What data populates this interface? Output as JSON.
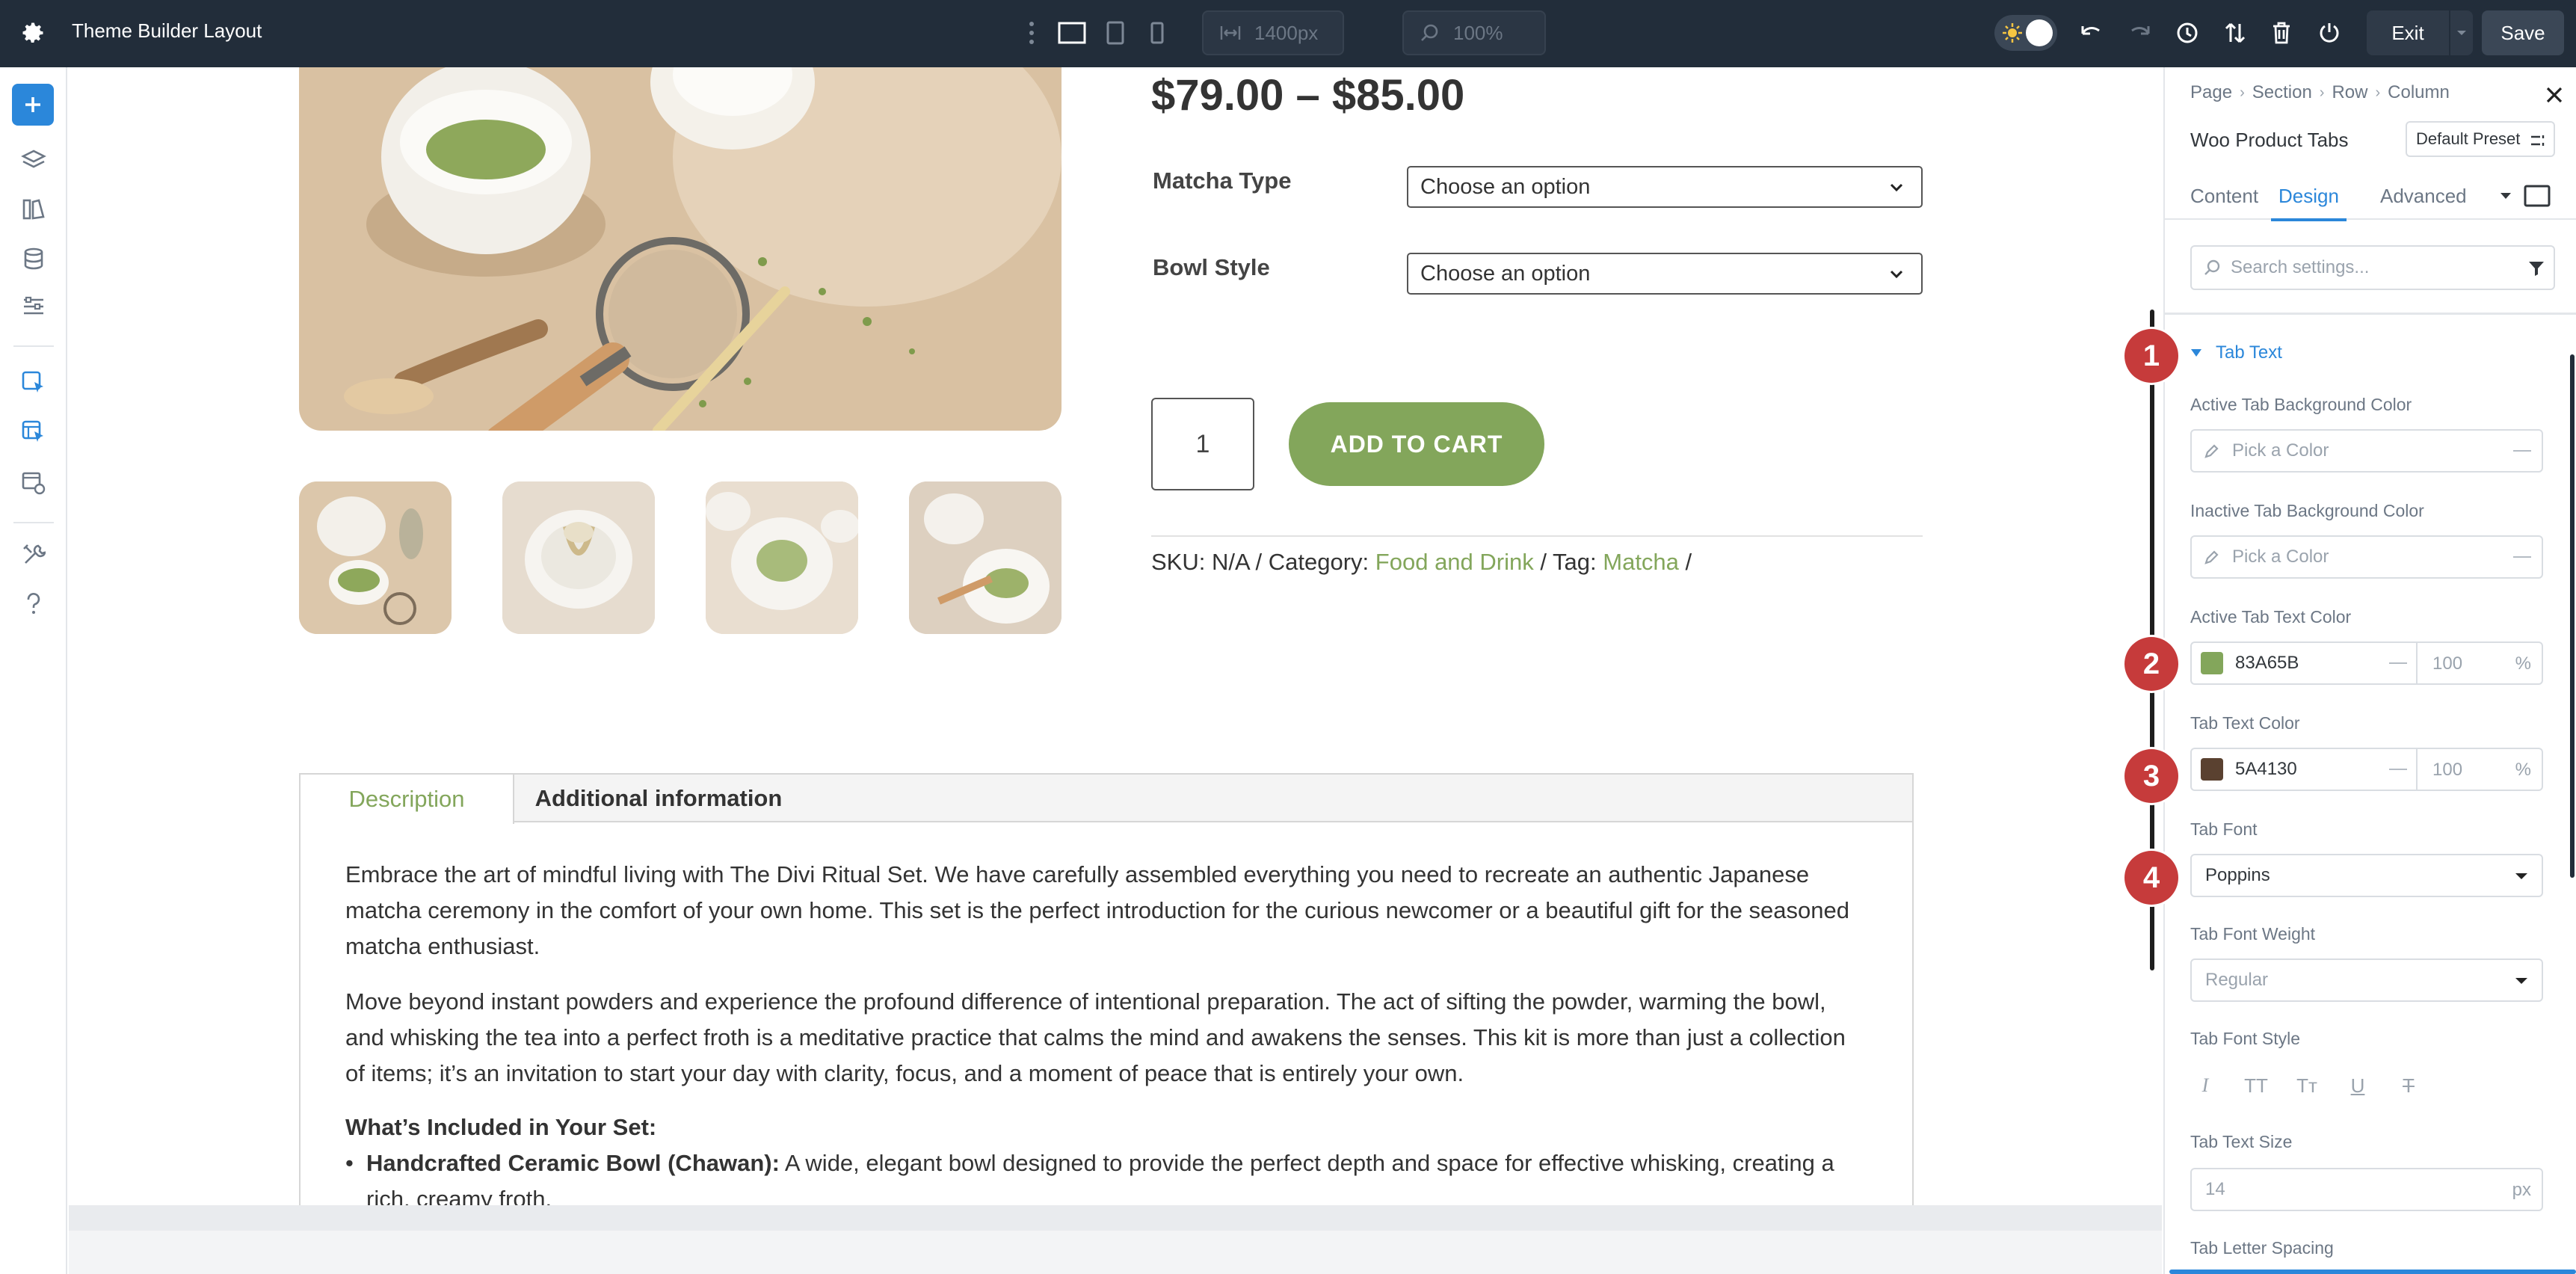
{
  "topbar": {
    "title": "Theme Builder Layout",
    "width_value": "1400px",
    "zoom_value": "100%",
    "exit_label": "Exit",
    "save_label": "Save"
  },
  "product": {
    "price": "$79.00 – $85.00",
    "options": [
      {
        "label": "Matcha Type",
        "value": "Choose an option"
      },
      {
        "label": "Bowl Style",
        "value": "Choose an option"
      }
    ],
    "quantity": "1",
    "add_to_cart": "ADD TO CART",
    "meta": {
      "sku": "SKU: N/A / Category: ",
      "category": "Food and Drink",
      "tag_prefix": " / Tag: ",
      "tag": "Matcha",
      "tail": " /"
    }
  },
  "tabs": {
    "items": [
      "Description",
      "Additional information"
    ],
    "paragraphs": [
      "Embrace the art of mindful living with The Divi Ritual Set. We have carefully assembled everything you need to recreate an authentic Japanese matcha ceremony in the comfort of your own home. This set is the perfect introduction for the curious newcomer or a beautiful gift for the seasoned matcha enthusiast.",
      "Move beyond instant powders and experience the profound difference of intentional preparation. The act of sifting the powder, warming the bowl, and whisking the tea into a perfect froth is a meditative practice that calms the mind and awakens the senses. This kit is more than just a collection of items; it’s an invitation to start your day with clarity, focus, and a moment of peace that is entirely your own."
    ],
    "included_heading": "What’s Included in Your Set:",
    "list": [
      {
        "bold": "Handcrafted Ceramic Bowl (Chawan):",
        "text": " A wide, elegant bowl designed to provide the perfect depth and space for effective whisking, creating a rich, creamy froth."
      }
    ]
  },
  "panel": {
    "breadcrumb": [
      "Page",
      "Section",
      "Row",
      "Column"
    ],
    "module_name": "Woo Product Tabs",
    "preset": "Default Preset",
    "tabs": [
      "Content",
      "Design",
      "Advanced"
    ],
    "search_placeholder": "Search settings...",
    "group_title": "Tab Text",
    "active_bg_label": "Active Tab Background Color",
    "inactive_bg_label": "Inactive Tab Background Color",
    "pick_color": "Pick a Color",
    "active_text_label": "Active Tab Text Color",
    "active_text_value": "83A65B",
    "active_text_color": "#83A65B",
    "text_color_label": "Tab Text Color",
    "text_color_value": "5A4130",
    "text_color_color": "#5A4130",
    "opacity": "100",
    "pct": "%",
    "font_label": "Tab Font",
    "font_value": "Poppins",
    "weight_label": "Tab Font Weight",
    "weight_value": "Regular",
    "style_label": "Tab Font Style",
    "font_style_icons": [
      "I",
      "TT",
      "Tт",
      "U",
      "T"
    ],
    "size_label": "Tab Text Size",
    "size_value": "14",
    "size_unit": "px",
    "spacing_label": "Tab Letter Spacing"
  },
  "annotations": [
    "1",
    "2",
    "3",
    "4"
  ],
  "colors": {
    "accent": "#2b87da",
    "brand_green": "#83a65b",
    "topbar": "#222d3a",
    "badge_red": "#c63b3b"
  }
}
